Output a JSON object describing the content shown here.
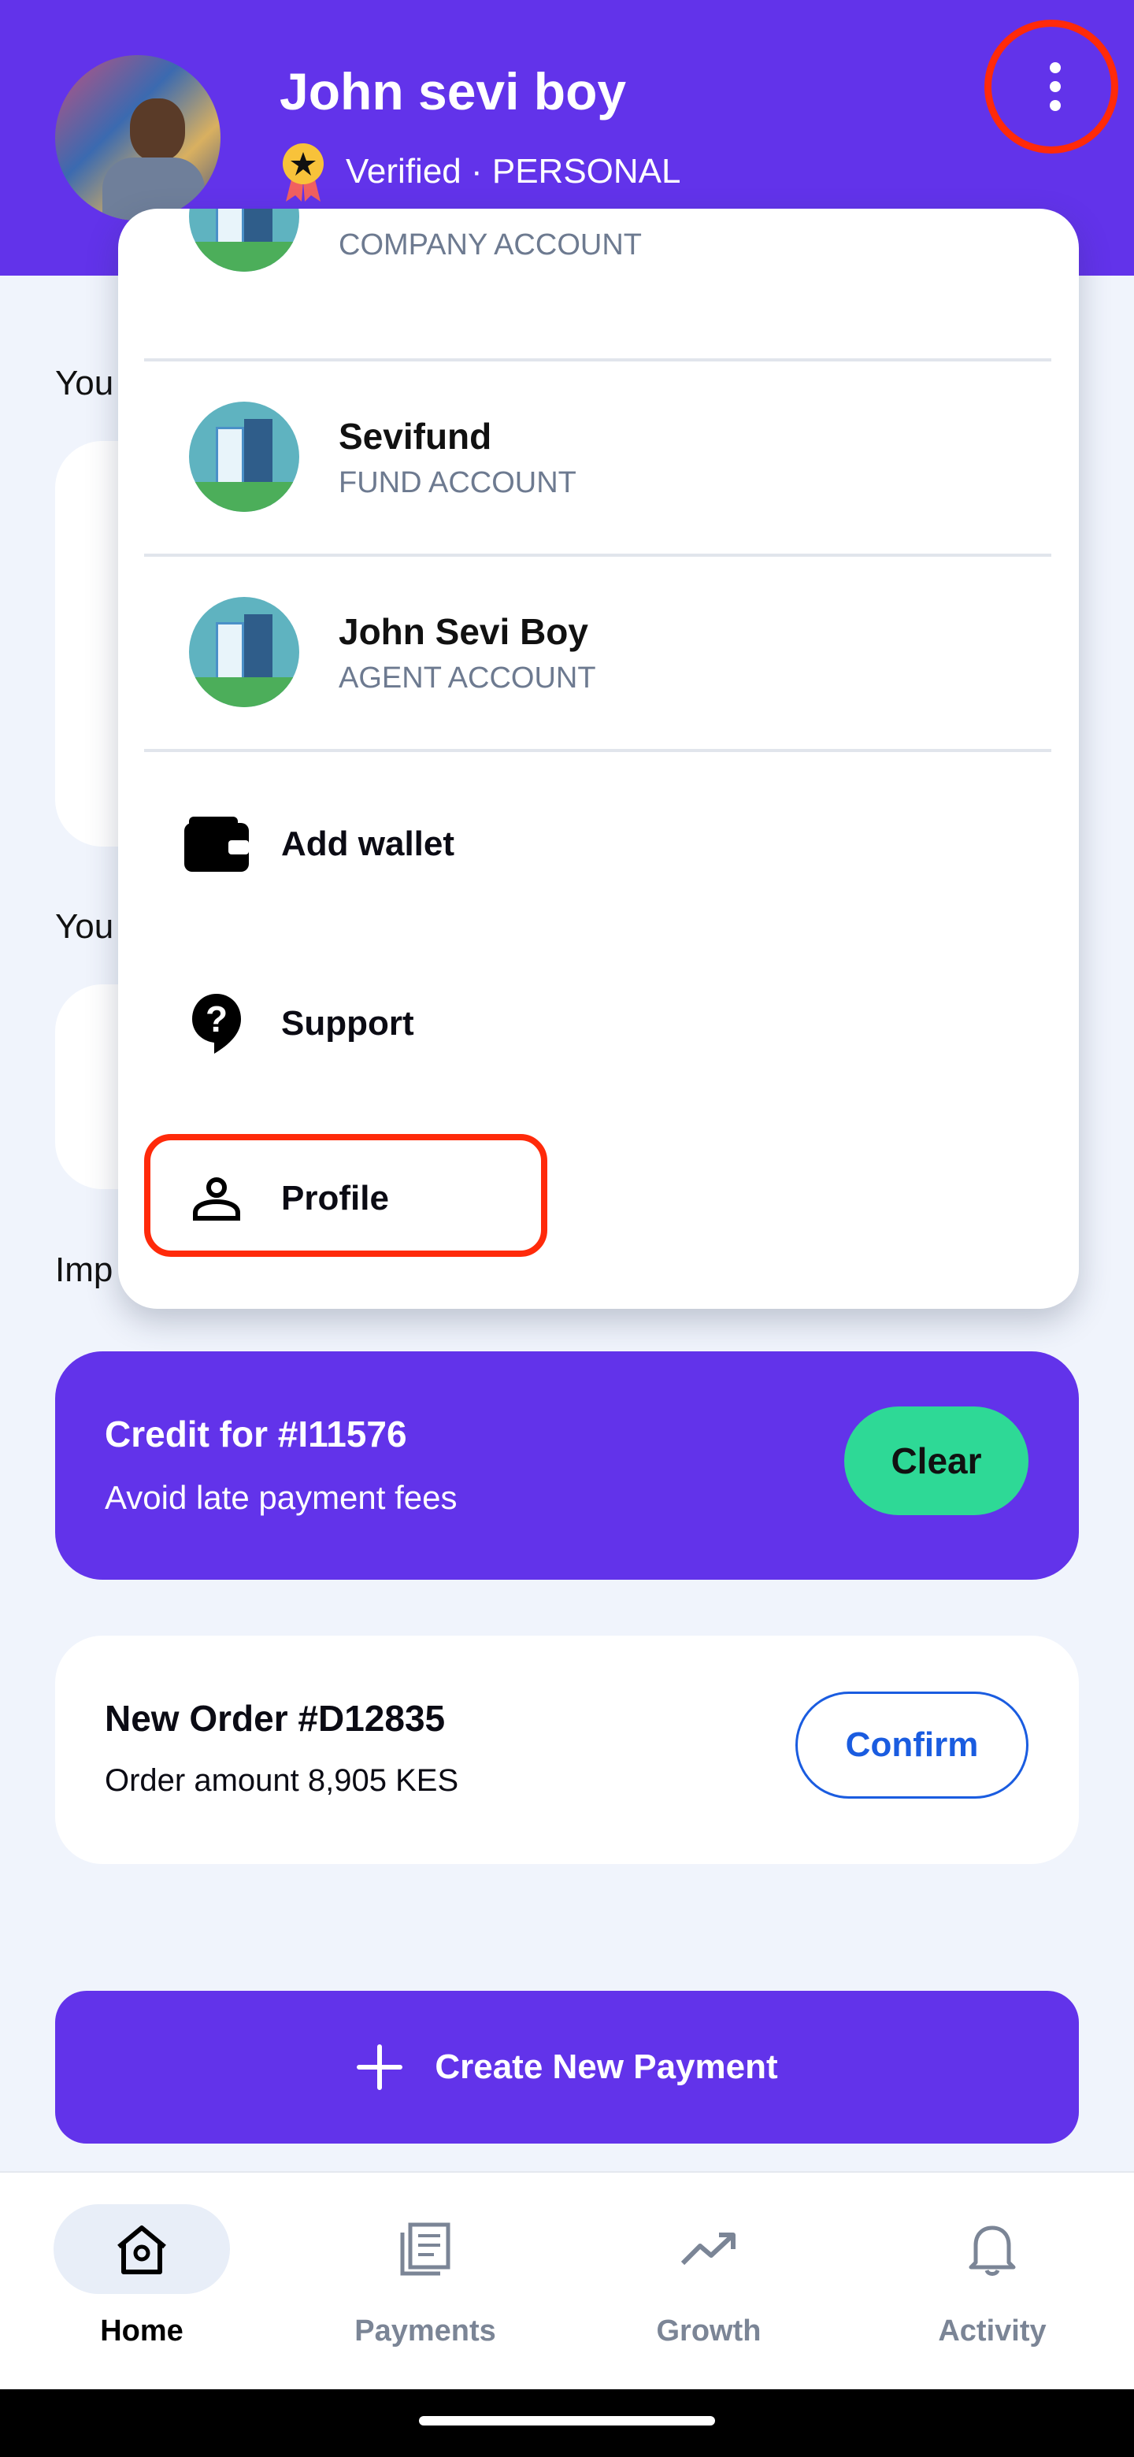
{
  "header": {
    "name": "John sevi boy",
    "status": "Verified · PERSONAL",
    "menu_icon": "kebab-menu-icon"
  },
  "background": {
    "section1": "You",
    "section2": "You",
    "section3": "Imp"
  },
  "menu": {
    "accounts": [
      {
        "title": "",
        "subtitle": "COMPANY ACCOUNT"
      },
      {
        "title": "Sevifund",
        "subtitle": "FUND ACCOUNT"
      },
      {
        "title": "John Sevi Boy",
        "subtitle": "AGENT ACCOUNT"
      }
    ],
    "items": [
      {
        "label": "Add wallet",
        "icon": "wallet-icon"
      },
      {
        "label": "Support",
        "icon": "help-bubble-icon"
      },
      {
        "label": "Profile",
        "icon": "person-icon"
      }
    ]
  },
  "credit": {
    "title": "Credit for #I11576",
    "subtitle": "Avoid late payment fees",
    "button": "Clear"
  },
  "order": {
    "title": "New Order #D12835",
    "subtitle": "Order amount 8,905 KES",
    "button": "Confirm"
  },
  "create_button": "Create New Payment",
  "nav": {
    "tabs": [
      {
        "label": "Home",
        "active": true
      },
      {
        "label": "Payments"
      },
      {
        "label": "Growth"
      },
      {
        "label": "Activity"
      }
    ]
  },
  "colors": {
    "primary": "#6233EA",
    "accent_green": "#2ED996",
    "link_blue": "#1a5ce0",
    "highlight": "#ff2a0a"
  }
}
